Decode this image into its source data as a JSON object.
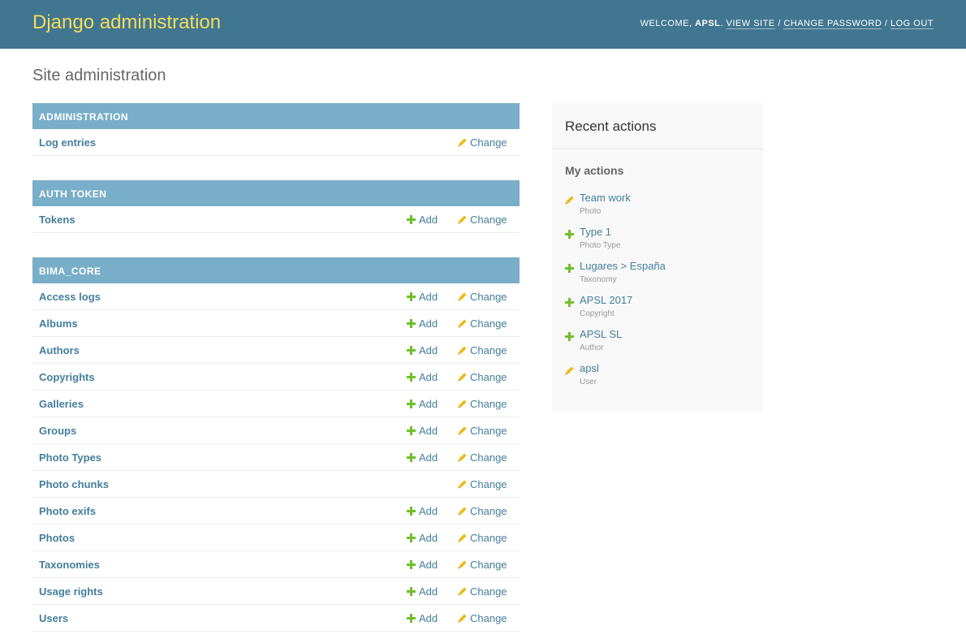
{
  "header": {
    "brand": "Django administration",
    "welcome": "Welcome, ",
    "username": "APSL",
    "view_site": "View site",
    "change_password": "Change password",
    "log_out": "Log out",
    "sep": " / "
  },
  "page_title": "Site administration",
  "labels": {
    "add": "Add",
    "change": "Change"
  },
  "colors": {
    "header_bg": "#417690",
    "brand": "#f5dd5d",
    "caption_bg": "#79aec8",
    "link": "#447e9b",
    "add_green": "#70bf2b",
    "change_yellow": "#efb80b"
  },
  "modules": [
    {
      "caption": "Administration",
      "rows": [
        {
          "name": "Log entries",
          "add": false
        }
      ]
    },
    {
      "caption": "Auth Token",
      "rows": [
        {
          "name": "Tokens",
          "add": true
        }
      ]
    },
    {
      "caption": "Bima_Core",
      "rows": [
        {
          "name": "Access logs",
          "add": true
        },
        {
          "name": "Albums",
          "add": true
        },
        {
          "name": "Authors",
          "add": true
        },
        {
          "name": "Copyrights",
          "add": true
        },
        {
          "name": "Galleries",
          "add": true
        },
        {
          "name": "Groups",
          "add": true
        },
        {
          "name": "Photo Types",
          "add": true
        },
        {
          "name": "Photo chunks",
          "add": false
        },
        {
          "name": "Photo exifs",
          "add": true
        },
        {
          "name": "Photos",
          "add": true
        },
        {
          "name": "Taxonomies",
          "add": true
        },
        {
          "name": "Usage rights",
          "add": true
        },
        {
          "name": "Users",
          "add": true
        }
      ]
    }
  ],
  "recent": {
    "title": "Recent actions",
    "subtitle": "My actions",
    "items": [
      {
        "icon": "pencil-icon",
        "name": "Team work",
        "type": "Photo"
      },
      {
        "icon": "plus-icon",
        "name": "Type 1",
        "type": "Photo Type"
      },
      {
        "icon": "plus-icon",
        "name": "Lugares > España",
        "type": "Taxonomy"
      },
      {
        "icon": "plus-icon",
        "name": "APSL 2017",
        "type": "Copyright"
      },
      {
        "icon": "plus-icon",
        "name": "APSL SL",
        "type": "Author"
      },
      {
        "icon": "pencil-icon",
        "name": "apsl",
        "type": "User"
      }
    ]
  }
}
